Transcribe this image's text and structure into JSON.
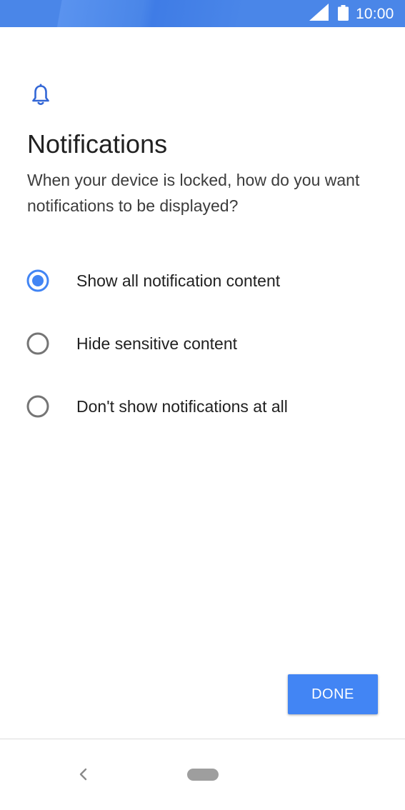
{
  "status_bar": {
    "time": "10:00",
    "icons": [
      "signal-icon",
      "battery-icon"
    ],
    "color": "#4a86e8"
  },
  "header": {
    "icon": "bell-icon",
    "title": "Notifications",
    "subtitle": "When your device is locked, how do you want notifications to be displayed?"
  },
  "options": [
    {
      "label": "Show all notification content",
      "selected": true
    },
    {
      "label": "Hide sensitive content",
      "selected": false
    },
    {
      "label": "Don't show notifications at all",
      "selected": false
    }
  ],
  "actions": {
    "done_label": "DONE",
    "accent_color": "#4285f4"
  },
  "nav_bar": {
    "icons": [
      "back-icon",
      "home-pill-icon"
    ]
  }
}
